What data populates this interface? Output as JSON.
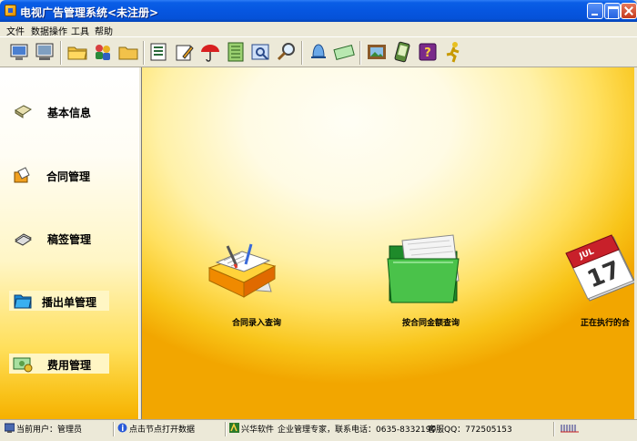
{
  "window": {
    "title": "电视广告管理系统<未注册>"
  },
  "menu": {
    "file": "文件",
    "data_ops": "数据操作",
    "tools": "工具",
    "help": "帮助"
  },
  "toolbar": {
    "buttons": [
      "monitor-icon",
      "screen-icon",
      "folder-open-icon",
      "users-icon",
      "folder-icon",
      "list-icon",
      "edit-icon",
      "umbrella-icon",
      "notebook-icon",
      "search-doc-icon",
      "search-icon",
      "bell-icon",
      "money-icon",
      "picture-icon",
      "tablet-icon",
      "help-book-icon",
      "runner-icon"
    ]
  },
  "sidebar": {
    "items": [
      {
        "label": "基本信息",
        "icon": "info-icon"
      },
      {
        "label": "合同管理",
        "icon": "contract-icon"
      },
      {
        "label": "稿签管理",
        "icon": "draft-icon"
      },
      {
        "label": "播出单管理",
        "icon": "broadcast-icon"
      },
      {
        "label": "费用管理",
        "icon": "cost-icon"
      }
    ]
  },
  "main": {
    "tiles": [
      {
        "label": "合同录入查询",
        "icon": "contract-entry-icon"
      },
      {
        "label": "按合同金额查询",
        "icon": "green-folder-icon"
      },
      {
        "label": "正在执行的合",
        "icon": "calendar-icon",
        "calendar_month": "JUL",
        "calendar_day": "17"
      }
    ]
  },
  "status": {
    "user": "当前用户：管理员",
    "hint": "点击节点打开数据",
    "company": "兴华软件",
    "slogan": "企业管理专家，联系电话：0635-8332190",
    "qq": "客服QQ：772505153"
  },
  "colors": {
    "title_blue": "#0656e0",
    "accent_yellow": "#f8c418",
    "green_folder": "#3aa63a",
    "calendar_red": "#c8202a"
  }
}
